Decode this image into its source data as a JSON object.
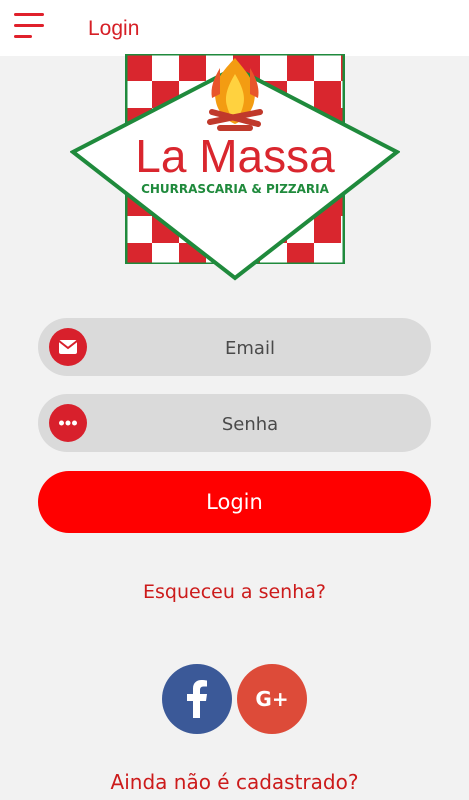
{
  "appbar": {
    "title": "Login",
    "menu_icon": "hamburger-menu-icon",
    "accent": "#d61f26"
  },
  "logo": {
    "brand": "La Massa",
    "tagline": "CHURRASCARIA & PIZZARIA",
    "colors": {
      "red": "#d9262e",
      "green": "#1f8a3c"
    }
  },
  "form": {
    "email_placeholder": "Email",
    "email_icon": "envelope-icon",
    "password_placeholder": "Senha",
    "password_icon": "dots-icon",
    "login_label": "Login",
    "login_color": "#ff0000"
  },
  "links": {
    "forgot": "Esqueceu a senha?",
    "signup": "Ainda não é cadastrado?"
  },
  "social": {
    "facebook_icon": "facebook-icon",
    "facebook_color": "#3b5998",
    "google_icon": "google-plus-icon",
    "google_color": "#dd4b39",
    "google_label": "G+"
  }
}
